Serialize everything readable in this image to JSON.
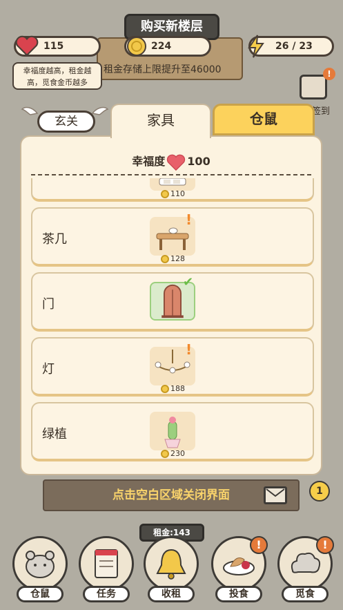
{
  "hud": {
    "title": "购买新楼层",
    "hearts": "115",
    "coins": "224",
    "energy": "26 / 23",
    "happiness_hint": "幸福度越高，租金越高，觅食金币越多",
    "rent_limit": "租金存储上限提升至46000",
    "signin_label": "签到",
    "calendar_badge": "!"
  },
  "tabs": {
    "gate": "玄关",
    "furniture": "家具",
    "hamster": "仓鼠"
  },
  "panel": {
    "happiness_label": "幸福度",
    "happiness_value": "100"
  },
  "items": [
    {
      "name": "",
      "price": "110",
      "state": "partial",
      "icon": "sofa-icon"
    },
    {
      "name": "茶几",
      "price": "128",
      "state": "new",
      "icon": "coffee-table-icon"
    },
    {
      "name": "门",
      "price": "",
      "state": "owned",
      "icon": "door-icon"
    },
    {
      "name": "灯",
      "price": "188",
      "state": "new",
      "icon": "chandelier-icon"
    },
    {
      "name": "绿植",
      "price": "230",
      "state": "buy",
      "icon": "cactus-icon"
    }
  ],
  "bottom": {
    "close_hint": "点击空白区域关闭界面",
    "mail_badge": "1",
    "rent_tag": "租金:143",
    "nav": [
      {
        "label": "仓鼠",
        "icon": "hamster-icon",
        "alert": ""
      },
      {
        "label": "任务",
        "icon": "task-icon",
        "alert": ""
      },
      {
        "label": "收租",
        "icon": "bell-icon",
        "alert": ""
      },
      {
        "label": "投食",
        "icon": "food-icon",
        "alert": "!"
      },
      {
        "label": "觅食",
        "icon": "forage-icon",
        "alert": "!"
      }
    ]
  },
  "colors": {
    "panel_bg": "#fcf3e0",
    "tab_active": "#fcd25c",
    "accent_orange": "#f28a2e",
    "owned_green": "#9ccf7e"
  }
}
